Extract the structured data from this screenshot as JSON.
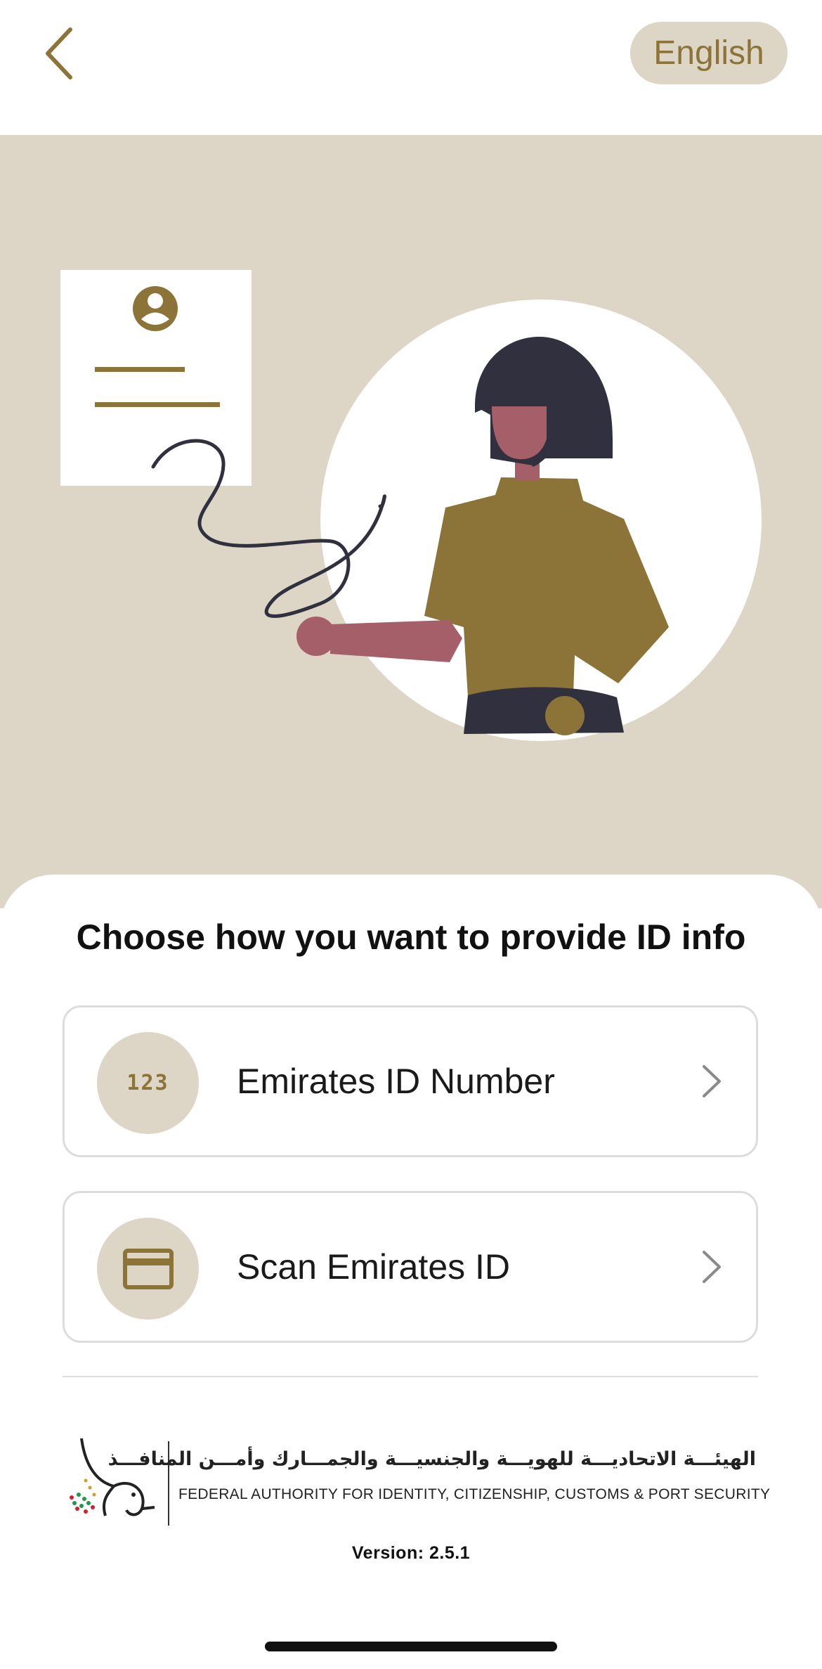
{
  "header": {
    "back_icon": "chevron-left-icon",
    "language_button": "English"
  },
  "colors": {
    "accent_gold": "#8c7338",
    "beige": "#ddd5c5",
    "text_dark": "#111111",
    "skin": "#a45f68",
    "hair_navy": "#30303f"
  },
  "hero": {
    "illustration": "woman-pointing-at-id-card-illustration"
  },
  "main": {
    "title": "Choose how you want to provide ID info",
    "options": [
      {
        "label": "Emirates ID Number",
        "icon": "number-123-icon",
        "icon_text": "123",
        "chevron": "chevron-right-icon"
      },
      {
        "label": "Scan Emirates ID",
        "icon": "card-icon",
        "chevron": "chevron-right-icon"
      }
    ]
  },
  "footer": {
    "logo": "falcon-emblem-logo",
    "org_name_ar": "الهيئـــة الاتحاديـــة للهويـــة والجنسيـــة والجمـــارك وأمـــن المنافـــذ",
    "org_name_en": "FEDERAL AUTHORITY FOR IDENTITY, CITIZENSHIP, CUSTOMS & PORT SECURITY",
    "version": "Version: 2.5.1"
  }
}
